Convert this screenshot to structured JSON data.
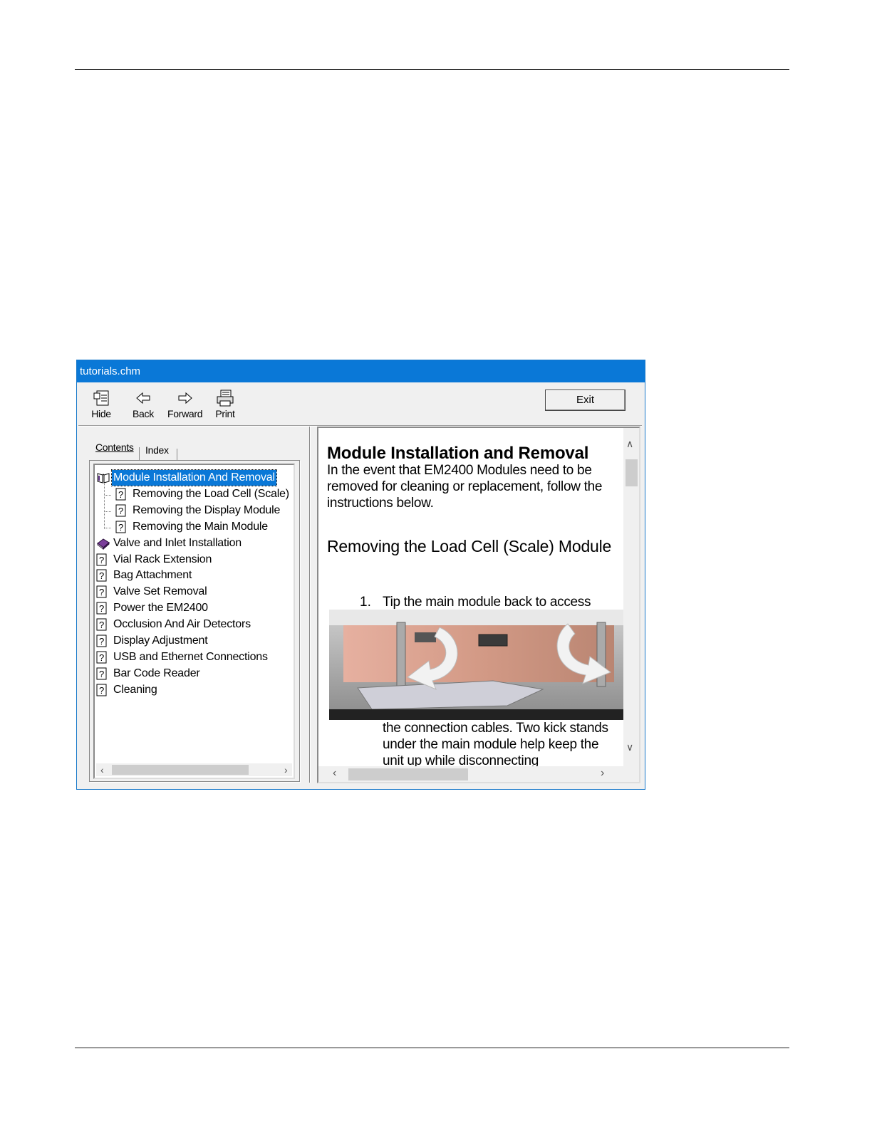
{
  "window": {
    "title": "tutorials.chm"
  },
  "toolbar": {
    "hide_label": "Hide",
    "back_label": "Back",
    "forward_label": "Forward",
    "print_label": "Print",
    "exit_label": "Exit"
  },
  "nav": {
    "tabs": [
      {
        "label": "Contents"
      },
      {
        "label": "Index"
      }
    ],
    "tree": [
      {
        "label": "Module Installation And Removal",
        "icon": "open-book-icon",
        "selected": true
      },
      {
        "label": "Removing the Load Cell (Scale)",
        "icon": "help-page-icon"
      },
      {
        "label": "Removing the Display Module",
        "icon": "help-page-icon"
      },
      {
        "label": "Removing the Main Module",
        "icon": "help-page-icon"
      },
      {
        "label": "Valve and Inlet Installation",
        "icon": "closed-book-icon"
      },
      {
        "label": "Vial Rack Extension",
        "icon": "help-page-icon"
      },
      {
        "label": "Bag Attachment",
        "icon": "help-page-icon"
      },
      {
        "label": "Valve Set Removal",
        "icon": "help-page-icon"
      },
      {
        "label": "Power the EM2400",
        "icon": "help-page-icon"
      },
      {
        "label": "Occlusion And Air Detectors",
        "icon": "help-page-icon"
      },
      {
        "label": "Display Adjustment",
        "icon": "help-page-icon"
      },
      {
        "label": "USB and Ethernet Connections",
        "icon": "help-page-icon"
      },
      {
        "label": "Bar Code Reader",
        "icon": "help-page-icon"
      },
      {
        "label": "Cleaning",
        "icon": "help-page-icon"
      }
    ]
  },
  "content": {
    "heading": "Module Installation and Removal",
    "intro": "In the event that EM2400 Modules need to be removed for cleaning or replacement, follow the instructions below.",
    "subheading": "Removing the Load Cell (Scale) Module",
    "step_number": "1.",
    "step_text_start": "Tip the main module back to access",
    "step_text_end": "the connection cables. Two kick stands under the main module help keep the unit up while disconnecting"
  },
  "colors": {
    "titlebar": "#0a78d7",
    "selection": "#0a78d7",
    "window_bg": "#f0f0f0"
  }
}
